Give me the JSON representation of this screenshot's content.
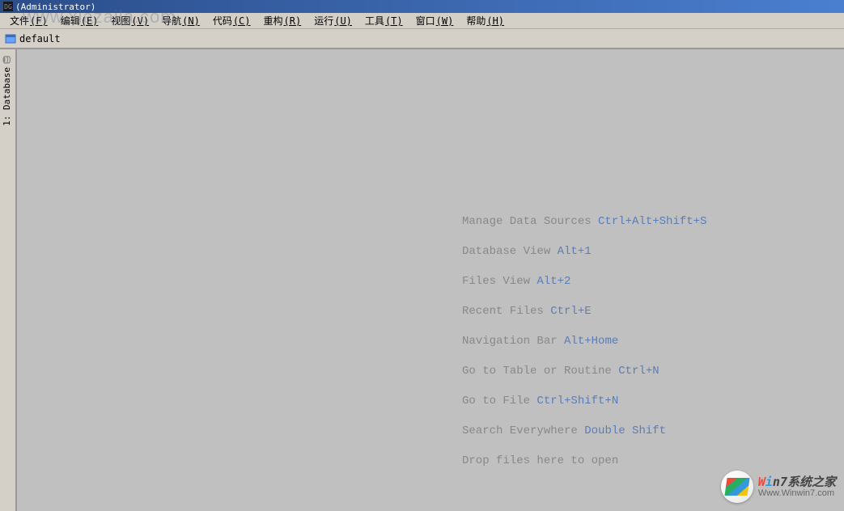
{
  "title": "(Administrator)",
  "app_icon_label": "DG",
  "watermark_top": "www.xiazaila.com",
  "menubar": [
    {
      "label": "文件",
      "mnemonic": "(F)"
    },
    {
      "label": "编辑",
      "mnemonic": "(E)"
    },
    {
      "label": "视图",
      "mnemonic": "(V)"
    },
    {
      "label": "导航",
      "mnemonic": "(N)"
    },
    {
      "label": "代码",
      "mnemonic": "(C)"
    },
    {
      "label": "重构",
      "mnemonic": "(R)"
    },
    {
      "label": "运行",
      "mnemonic": "(U)"
    },
    {
      "label": "工具",
      "mnemonic": "(T)"
    },
    {
      "label": "窗口",
      "mnemonic": "(W)"
    },
    {
      "label": "帮助",
      "mnemonic": "(H)"
    }
  ],
  "navbar": {
    "label": "default"
  },
  "sidebar": {
    "database_tab": "1: Database"
  },
  "shortcuts": [
    {
      "label": "Manage Data Sources ",
      "keys": "Ctrl+Alt+Shift+S"
    },
    {
      "label": "Database View ",
      "keys": "Alt+1"
    },
    {
      "label": "Files View ",
      "keys": "Alt+2"
    },
    {
      "label": "Recent Files ",
      "keys": "Ctrl+E"
    },
    {
      "label": "Navigation Bar ",
      "keys": "Alt+Home"
    },
    {
      "label": "Go to Table or Routine ",
      "keys": "Ctrl+N"
    },
    {
      "label": "Go to File ",
      "keys": "Ctrl+Shift+N"
    },
    {
      "label": "Search Everywhere ",
      "keys": "Double Shift"
    },
    {
      "label": "Drop files here to open",
      "keys": ""
    }
  ],
  "watermark_logo": {
    "cn": "Win7系统之家",
    "en": "Www.Winwin7.com"
  }
}
